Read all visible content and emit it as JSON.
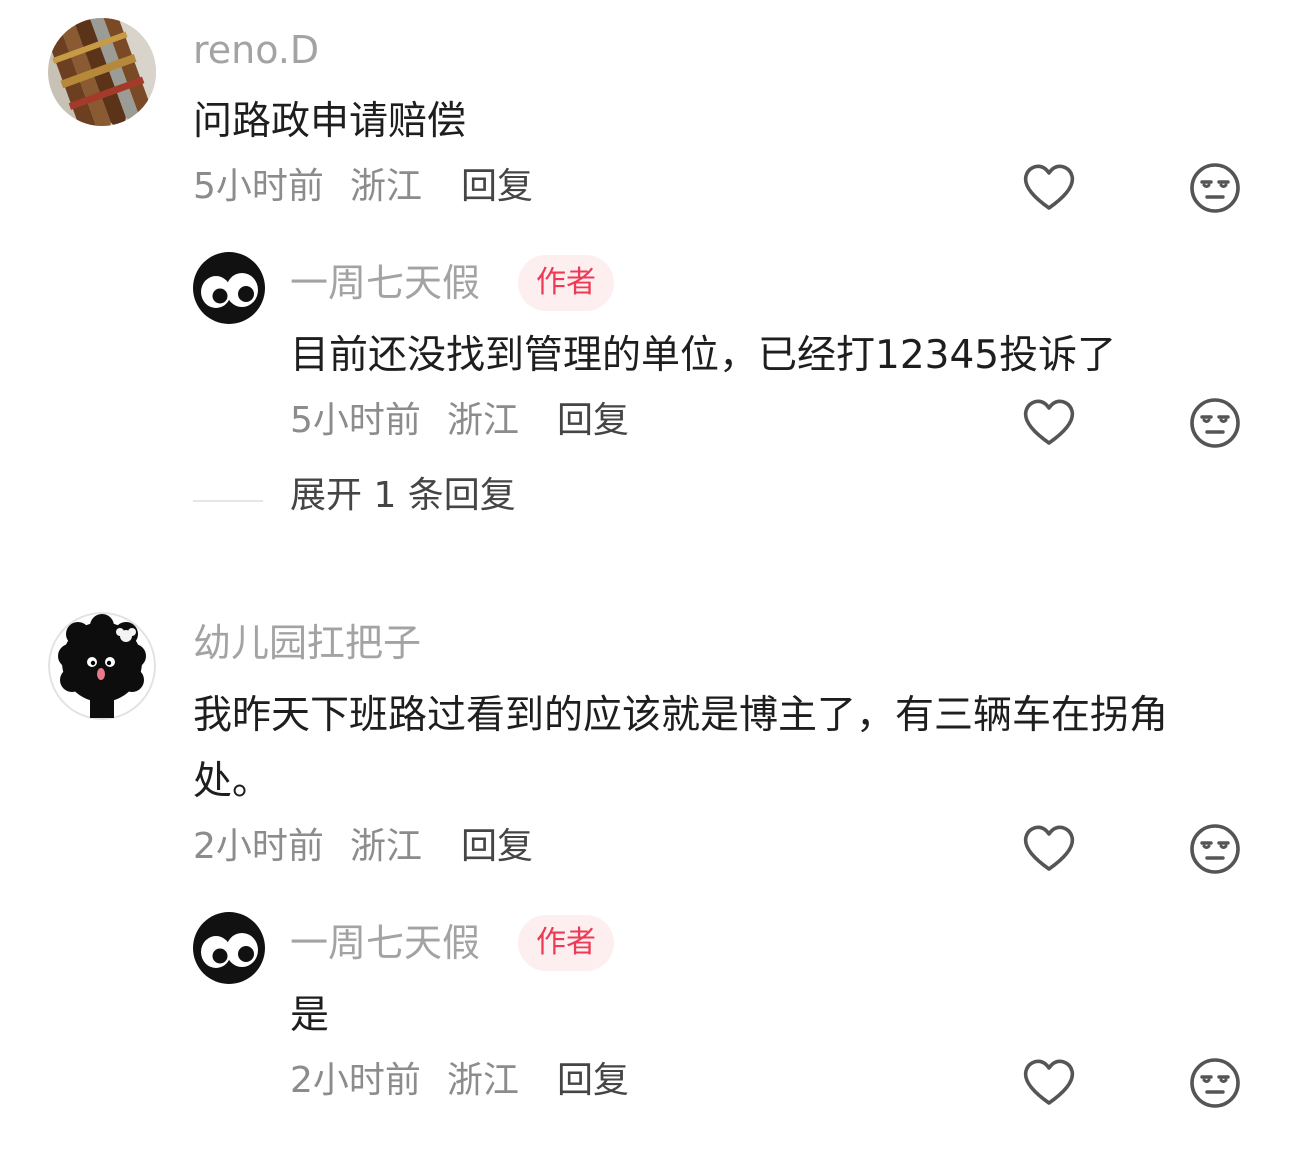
{
  "comments": [
    {
      "username": "reno.D",
      "avatar_icon": "cigar-photo-avatar",
      "text": "问路政申请赔偿",
      "time": "5小时前",
      "location": "浙江",
      "reply_label": "回复",
      "replies": [
        {
          "username": "一周七天假",
          "avatar_icon": "googly-eyes-avatar",
          "badge": "作者",
          "text": "目前还没找到管理的单位，已经打12345投诉了",
          "time": "5小时前",
          "location": "浙江",
          "reply_label": "回复"
        }
      ],
      "expand_label": "展开 1 条回复"
    },
    {
      "username": "幼儿园扛把子",
      "avatar_icon": "fluffy-black-creature-avatar",
      "text": "我昨天下班路过看到的应该就是博主了，有三辆车在拐角处。",
      "time": "2小时前",
      "location": "浙江",
      "reply_label": "回复",
      "replies": [
        {
          "username": "一周七天假",
          "avatar_icon": "googly-eyes-avatar",
          "badge": "作者",
          "text": "是",
          "time": "2小时前",
          "location": "浙江",
          "reply_label": "回复"
        }
      ]
    }
  ],
  "icons": {
    "like": "heart-outline-icon",
    "dislike": "unamused-face-icon"
  },
  "colors": {
    "badge_text": "#ee3a55",
    "badge_bg": "#fdeef0",
    "meta": "#8c8c8c",
    "username": "#a3a3a3"
  }
}
